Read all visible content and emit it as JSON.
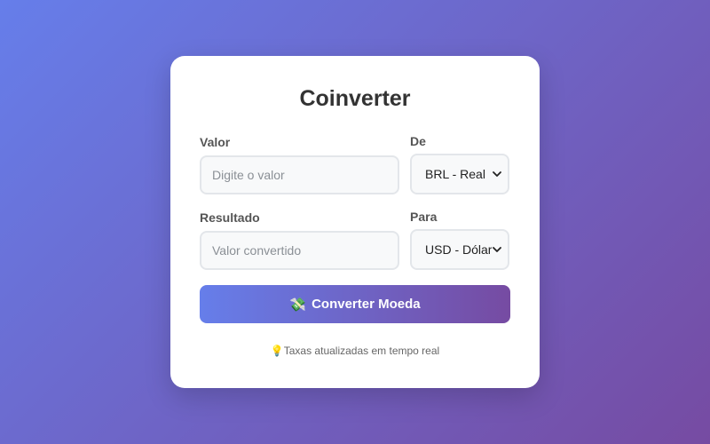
{
  "app": {
    "title": "Coinverter"
  },
  "form": {
    "valor_label": "Valor",
    "valor_placeholder": "Digite o valor",
    "valor_value": "",
    "de_label": "De",
    "de_selected": "BRL - Real",
    "resultado_label": "Resultado",
    "resultado_placeholder": "Valor convertido",
    "resultado_value": "",
    "para_label": "Para",
    "para_selected": "USD - Dólar"
  },
  "button": {
    "icon": "💸",
    "icon_name": "money-with-wings-icon",
    "label": "Converter Moeda"
  },
  "footer": {
    "icon": "💡",
    "icon_name": "lightbulb-icon",
    "text": "Taxas atualizadas em tempo real"
  },
  "colors": {
    "gradient_start": "#667eea",
    "gradient_end": "#764ba2",
    "card": "#ffffff",
    "title": "#333333"
  }
}
